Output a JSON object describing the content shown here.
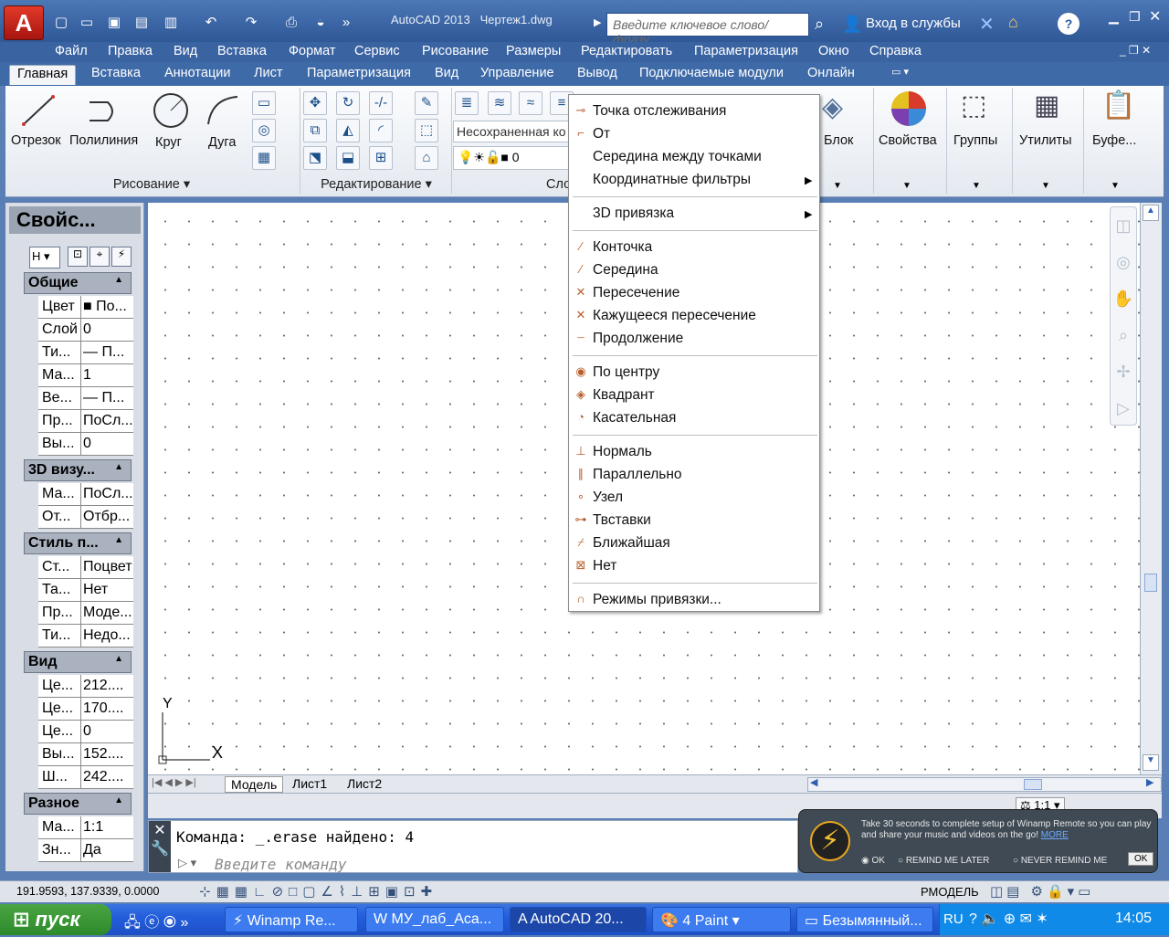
{
  "titlebar": {
    "app": "AutoCAD 2013",
    "file": "Чертеж1.dwg",
    "search_placeholder": "Введите ключевое слово/фразу",
    "signin": "Вход в службы"
  },
  "menu": [
    "Файл",
    "Правка",
    "Вид",
    "Вставка",
    "Формат",
    "Сервис",
    "Рисование",
    "Размеры",
    "Редактировать",
    "Параметризация",
    "Окно",
    "Справка"
  ],
  "ribbon_tabs": [
    "Главная",
    "Вставка",
    "Аннотации",
    "Лист",
    "Параметризация",
    "Вид",
    "Управление",
    "Вывод",
    "Подключаемые модули",
    "Онлайн"
  ],
  "ribbon": {
    "draw": [
      "Отрезок",
      "Полилиния",
      "Круг",
      "Дуга"
    ],
    "draw_panel": "Рисование",
    "modify_panel": "Редактирование",
    "layer_name": "Несохраненная ко",
    "layer_num": "0",
    "layers_panel": "Сло",
    "block": "Блок",
    "props": "Свойства",
    "groups": "Группы",
    "utils": "Утилиты",
    "clip": "Буфе..."
  },
  "props_panel": {
    "title": "Свойс...",
    "sections": [
      {
        "name": "Общие",
        "rows": [
          [
            "Цвет",
            "■ По..."
          ],
          [
            "Слой",
            "0"
          ],
          [
            "Ти...",
            "— П..."
          ],
          [
            "Ма...",
            "1"
          ],
          [
            "Ве...",
            "— П..."
          ],
          [
            "Пр...",
            "ПоСл..."
          ],
          [
            "Вы...",
            "0"
          ]
        ]
      },
      {
        "name": "3D визу...",
        "rows": [
          [
            "Ма...",
            "ПоСл..."
          ],
          [
            "От...",
            "Отбр..."
          ]
        ]
      },
      {
        "name": "Стиль п...",
        "rows": [
          [
            "Ст...",
            "Поцвет"
          ],
          [
            "Та...",
            "Нет"
          ],
          [
            "Пр...",
            "Моде..."
          ],
          [
            "Ти...",
            "Недо..."
          ]
        ]
      },
      {
        "name": "Вид",
        "rows": [
          [
            "Це...",
            "212...."
          ],
          [
            "Це...",
            "170...."
          ],
          [
            "Це...",
            "0"
          ],
          [
            "Вы...",
            "152...."
          ],
          [
            "Ш...",
            "242...."
          ]
        ]
      },
      {
        "name": "Разное",
        "rows": [
          [
            "Ма...",
            "1:1"
          ],
          [
            "Зн...",
            "Да"
          ]
        ]
      }
    ]
  },
  "context_menu": [
    {
      "label": "Точка отслеживания",
      "icon": "tracking-icon"
    },
    {
      "label": "От",
      "icon": "from-icon"
    },
    {
      "label": "Середина между точками",
      "icon": ""
    },
    {
      "label": "Координатные фильтры",
      "icon": "",
      "sub": true
    },
    {
      "sep": true
    },
    {
      "label": "3D привязка",
      "icon": "",
      "sub": true
    },
    {
      "sep": true
    },
    {
      "label": "Конточка",
      "icon": "endpoint-icon"
    },
    {
      "label": "Середина",
      "icon": "midpoint-icon"
    },
    {
      "label": "Пересечение",
      "icon": "intersection-icon"
    },
    {
      "label": "Кажущееся пересечение",
      "icon": "apparent-intersection-icon"
    },
    {
      "label": "Продолжение",
      "icon": "extension-icon"
    },
    {
      "sep": true
    },
    {
      "label": "По центру",
      "icon": "center-icon"
    },
    {
      "label": "Квадрант",
      "icon": "quadrant-icon"
    },
    {
      "label": "Касательная",
      "icon": "tangent-icon"
    },
    {
      "sep": true
    },
    {
      "label": "Нормаль",
      "icon": "perpendicular-icon"
    },
    {
      "label": "Параллельно",
      "icon": "parallel-icon"
    },
    {
      "label": "Узел",
      "icon": "node-icon"
    },
    {
      "label": "Твставки",
      "icon": "insert-icon"
    },
    {
      "label": "Ближайшая",
      "icon": "nearest-icon"
    },
    {
      "label": "Нет",
      "icon": "none-icon"
    },
    {
      "sep": true
    },
    {
      "label": "Режимы привязки...",
      "icon": "osnap-settings-icon"
    }
  ],
  "layout_tabs": [
    "Модель",
    "Лист1",
    "Лист2"
  ],
  "command": {
    "history": "Команда: _.erase найдено: 4",
    "prompt": "Введите команду"
  },
  "status": {
    "coords": "191.9593, 137.9339, 0.0000",
    "model": "РМОДЕЛЬ",
    "scale": "1:1"
  },
  "ucs": {
    "x": "X",
    "y": "Y"
  },
  "winamp": {
    "text": "Take 30 seconds to complete setup of Winamp Remote so you can play and share your music and videos on the go!",
    "more": "MORE",
    "opt1": "OK",
    "opt2": "REMIND ME LATER",
    "opt3": "NEVER REMIND ME",
    "ok": "OK"
  },
  "taskbar": {
    "start": "пуск",
    "items": [
      "Winamp Re...",
      "МУ_лаб_Аса...",
      "AutoCAD 20...",
      "4 Paint",
      "Безымянный..."
    ],
    "lang": "RU",
    "time": "14:05"
  }
}
